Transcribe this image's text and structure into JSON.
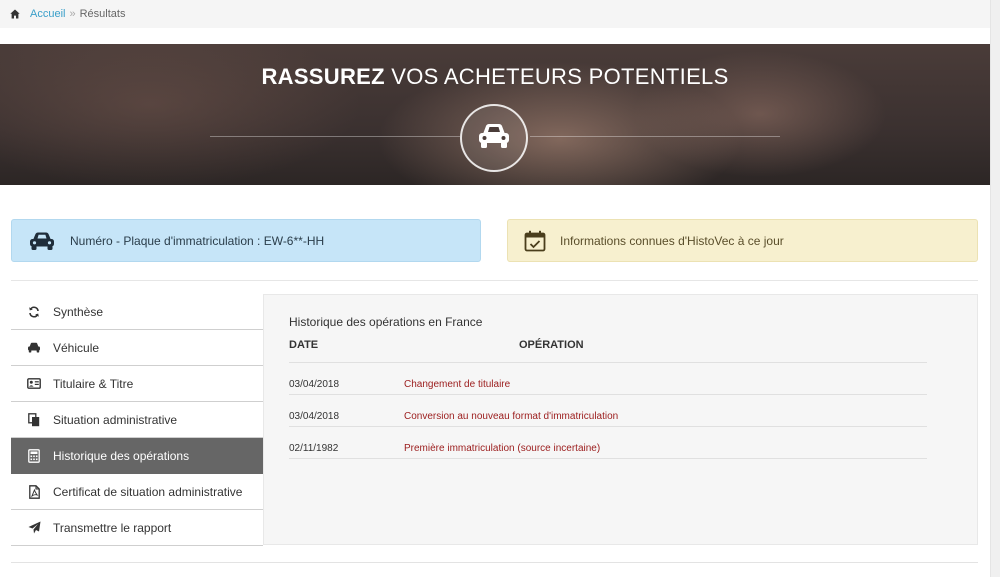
{
  "breadcrumb": {
    "home": "Accueil",
    "separator": "»",
    "current": "Résultats"
  },
  "hero": {
    "title_strong": "RASSUREZ",
    "title_rest": " VOS ACHETEURS POTENTIELS",
    "icon": "car-icon"
  },
  "plate_box": {
    "label": "Numéro - Plaque d'immatriculation : EW-6**-HH",
    "icon": "car-icon"
  },
  "info_box": {
    "label": "Informations connues d'HistoVec à ce jour",
    "icon": "calendar-check-icon"
  },
  "sidebar": {
    "items": [
      {
        "label": "Synthèse",
        "icon": "refresh-icon",
        "active": false
      },
      {
        "label": "Véhicule",
        "icon": "car-icon",
        "active": false
      },
      {
        "label": "Titulaire & Titre",
        "icon": "id-card-icon",
        "active": false
      },
      {
        "label": "Situation administrative",
        "icon": "documents-icon",
        "active": false
      },
      {
        "label": "Historique des opérations",
        "icon": "calculator-icon",
        "active": true
      },
      {
        "label": "Certificat de situation administrative",
        "icon": "pdf-file-icon",
        "active": false
      },
      {
        "label": "Transmettre le rapport",
        "icon": "send-icon",
        "active": false
      }
    ]
  },
  "history": {
    "title": "Historique des opérations en France",
    "columns": {
      "date": "DATE",
      "operation": "OPÉRATION"
    },
    "rows": [
      {
        "date": "03/04/2018",
        "operation": "Changement de titulaire"
      },
      {
        "date": "03/04/2018",
        "operation": "Conversion au nouveau format d'immatriculation"
      },
      {
        "date": "02/11/1982",
        "operation": "Première immatriculation (source incertaine)"
      }
    ]
  },
  "colors": {
    "active_nav": "#666666",
    "plate_bg": "#c6e5f8",
    "info_bg": "#f7f0cf",
    "operation_text": "#9b1c1c",
    "link": "#3a9fc9"
  }
}
